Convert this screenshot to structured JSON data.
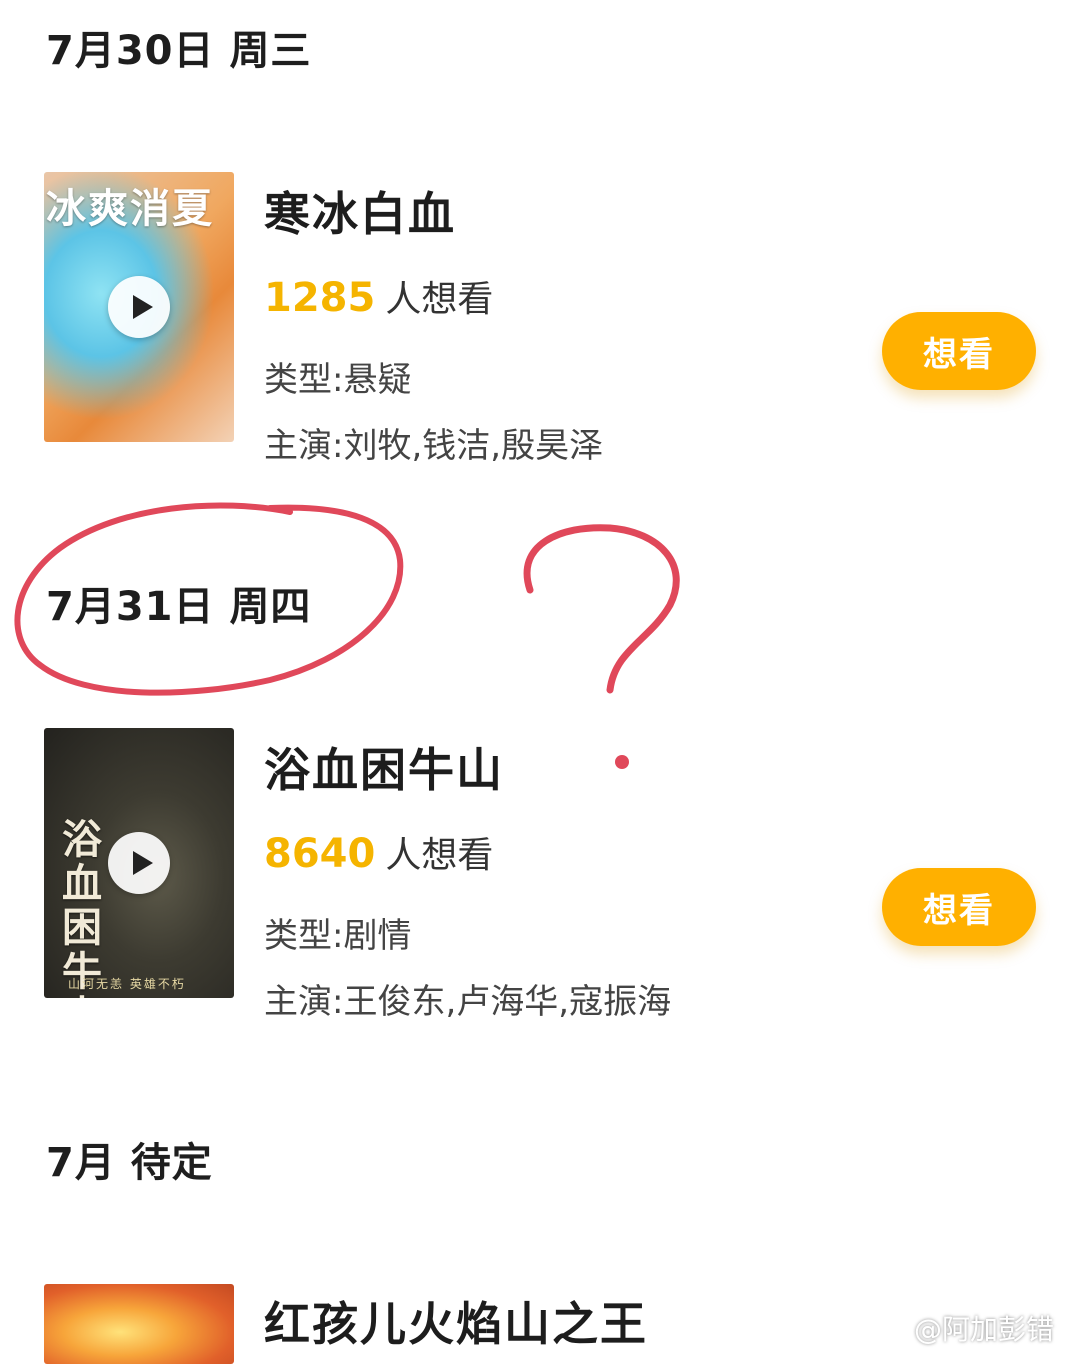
{
  "sections": [
    {
      "date": "7月30日",
      "weekday": "周三"
    },
    {
      "date": "7月31日",
      "weekday": "周四"
    },
    {
      "date": "7月",
      "weekday": "待定"
    }
  ],
  "movies": [
    {
      "title": "寒冰白血",
      "want_count": "1285",
      "want_suffix": "人想看",
      "genre": "类型:悬疑",
      "cast": "主演:刘牧,钱洁,殷昊泽",
      "poster_text": "冰爽消夏",
      "button": "想看"
    },
    {
      "title": "浴血困牛山",
      "want_count": "8640",
      "want_suffix": "人想看",
      "genre": "类型:剧情",
      "cast": "主演:王俊东,卢海华,寇振海",
      "poster_text": "浴血困牛山",
      "poster_bottom": "山河无恙  英雄不朽",
      "button": "想看"
    },
    {
      "title": "红孩儿火焰山之王"
    }
  ],
  "watermark": "@阿加彭错",
  "colors": {
    "accent": "#ffb000",
    "count": "#f5b400",
    "annotation": "#e0485a"
  },
  "icons": [
    "play-icon"
  ]
}
